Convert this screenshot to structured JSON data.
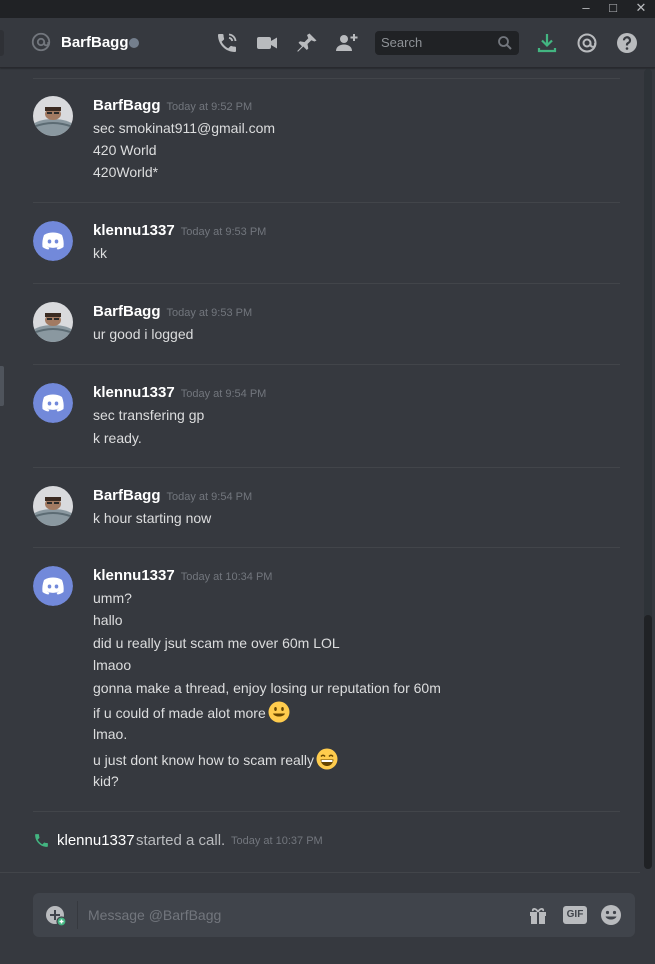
{
  "window": {
    "minimize_glyph": "–",
    "maximize_glyph": "□",
    "close_glyph": "✕"
  },
  "header": {
    "dm_name": "BarfBagg",
    "status": "offline",
    "search_placeholder": "Search",
    "icons": [
      "voice-call-icon",
      "video-call-icon",
      "pinned-messages-icon",
      "add-friend-icon",
      "download-icon",
      "mentions-icon",
      "help-icon"
    ]
  },
  "messages": [
    {
      "author": "BarfBagg",
      "avatar": "photo-avatar",
      "timestamp": "Today at 9:52 PM",
      "lines": [
        "sec smokinat911@gmail.com",
        "420 World",
        "420World*"
      ]
    },
    {
      "author": "klennu1337",
      "avatar": "discord-default-avatar",
      "timestamp": "Today at 9:53 PM",
      "lines": [
        "kk"
      ]
    },
    {
      "author": "BarfBagg",
      "avatar": "photo-avatar",
      "timestamp": "Today at 9:53 PM",
      "lines": [
        "ur good i logged"
      ]
    },
    {
      "author": "klennu1337",
      "avatar": "discord-default-avatar",
      "timestamp": "Today at 9:54 PM",
      "lines": [
        "sec transfering gp",
        "k ready."
      ]
    },
    {
      "author": "BarfBagg",
      "avatar": "photo-avatar",
      "timestamp": "Today at 9:54 PM",
      "lines": [
        "k hour starting now"
      ]
    },
    {
      "author": "klennu1337",
      "avatar": "discord-default-avatar",
      "timestamp": "Today at 10:34 PM",
      "lines": [
        "umm?",
        "hallo",
        "did u really jsut scam me over 60m LOL",
        "lmaoo",
        "gonna make a thread, enjoy losing ur reputation for 60m",
        "if u could of made alot more",
        "lmao.",
        "u just dont know how to scam really",
        "kid?"
      ],
      "line_emojis": {
        "5": "smiley-emoji",
        "7": "grinning-emoji"
      }
    }
  ],
  "system_message": {
    "icon": "phone-call-icon",
    "user": "klennu1337",
    "text": "started a call.",
    "timestamp": "Today at 10:37 PM"
  },
  "composer": {
    "placeholder": "Message @BarfBagg",
    "gif_label": "GIF",
    "icons": [
      "upload-icon",
      "gift-icon",
      "gif-icon",
      "emoji-picker-icon"
    ]
  },
  "colors": {
    "background": "#36393f",
    "accent_green": "#43b581",
    "discord_blurple": "#7289da",
    "username": "#ffffff",
    "timestamp": "#72767d"
  }
}
